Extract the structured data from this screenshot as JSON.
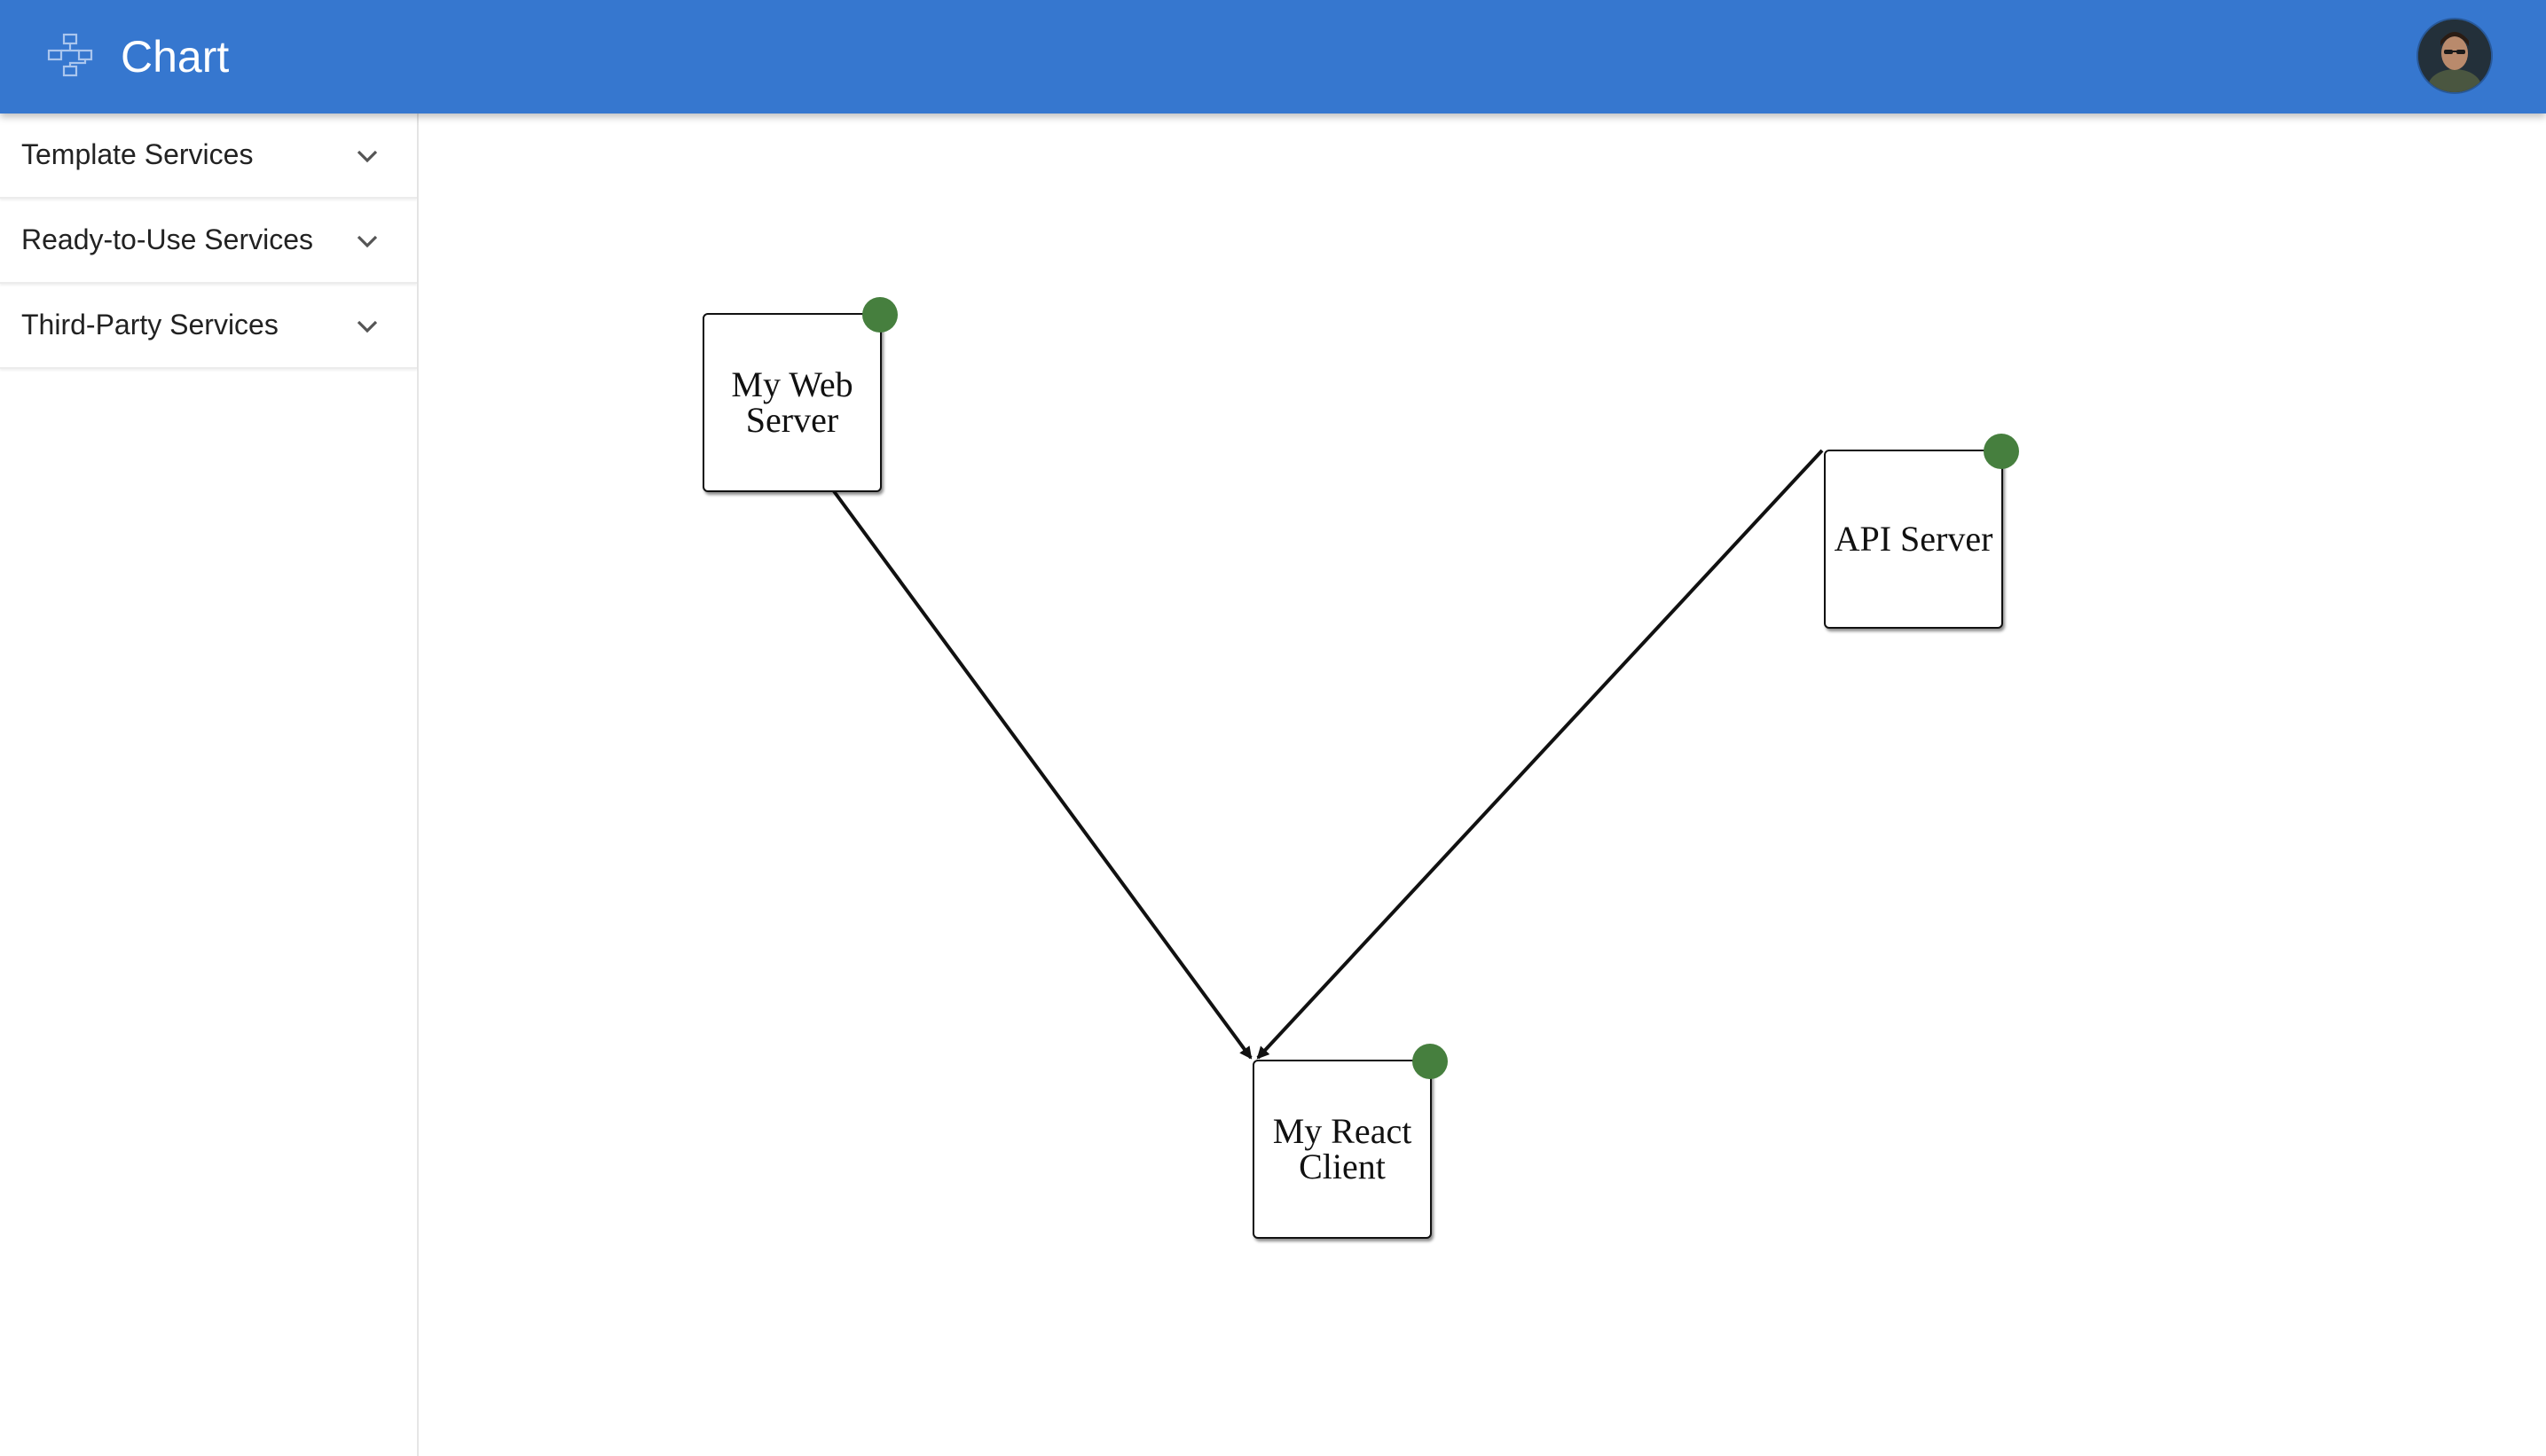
{
  "app": {
    "title": "Chart",
    "logo_icon": "flowchart-icon",
    "avatar": "user-avatar"
  },
  "sidebar": {
    "items": [
      {
        "label": "Template Services",
        "icon": "chevron-down-icon"
      },
      {
        "label": "Ready-to-Use Services",
        "icon": "chevron-down-icon"
      },
      {
        "label": "Third-Party Services",
        "icon": "chevron-down-icon"
      }
    ]
  },
  "diagram": {
    "nodes": [
      {
        "id": "web",
        "label": "My Web Server"
      },
      {
        "id": "api",
        "label": "API Server"
      },
      {
        "id": "react",
        "label": "My React Client"
      }
    ],
    "edges": [
      {
        "from": "web",
        "to": "react"
      },
      {
        "from": "api",
        "to": "react"
      }
    ]
  },
  "colors": {
    "appbar": "#3677cf",
    "status_ok": "#467f3e",
    "node_border": "#111111"
  }
}
